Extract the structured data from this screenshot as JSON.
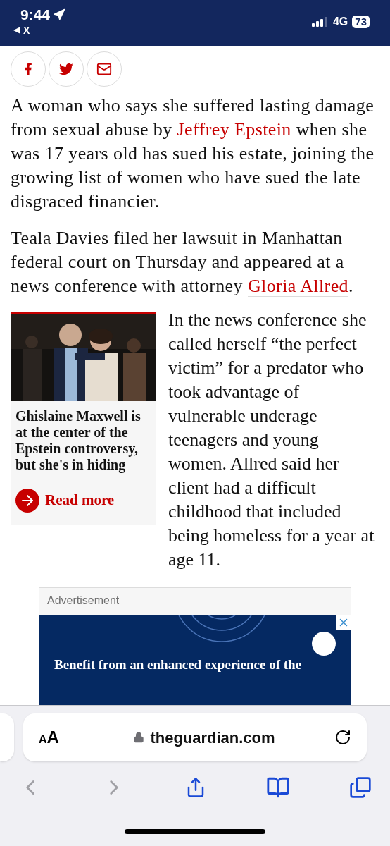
{
  "status_bar": {
    "time": "9:44",
    "back_label": "X",
    "network": "4G",
    "battery": "73"
  },
  "share_buttons": [
    {
      "kind": "facebook"
    },
    {
      "kind": "twitter"
    },
    {
      "kind": "email"
    }
  ],
  "paragraphs": [
    {
      "segments": [
        {
          "kind": "text",
          "text": "A woman who says she suffered lasting damage from sexual abuse by "
        },
        {
          "kind": "link",
          "text": "Jeffrey Epstein"
        },
        {
          "kind": "text",
          "text": " when she was 17 years old has sued his estate, joining the growing list of women who have sued the late disgraced financier."
        }
      ]
    },
    {
      "segments": [
        {
          "kind": "text",
          "text": "Teala Davies filed her lawsuit in Manhattan federal court on Thursday and appeared at a news conference with attorney "
        },
        {
          "kind": "link",
          "text": "Gloria Allred"
        },
        {
          "kind": "text",
          "text": "."
        }
      ]
    }
  ],
  "related": {
    "kind": "picture",
    "caption": "Ghislaine Maxwell is at the center of the Epstein controversy, but she's in hiding",
    "link": "Read more"
  },
  "floated_paragraph": "In the news conference she called herself “the perfect victim” for a predator who took advantage of vulnerable underage teenagers and young women. Allred said her client had a difficult childhood that included being homeless for a year at age 11.",
  "advertisement": {
    "label": "Advertisement",
    "headline": "Benefit from an enhanced experience of the"
  },
  "browser": {
    "text_size": "AA",
    "url": "theguardian.com",
    "toolbar": [
      {
        "kind": "back",
        "disabled": true
      },
      {
        "kind": "forward",
        "disabled": true
      },
      {
        "kind": "share",
        "disabled": false
      },
      {
        "kind": "bookmarks",
        "disabled": false
      },
      {
        "kind": "tabs",
        "disabled": false
      }
    ]
  }
}
